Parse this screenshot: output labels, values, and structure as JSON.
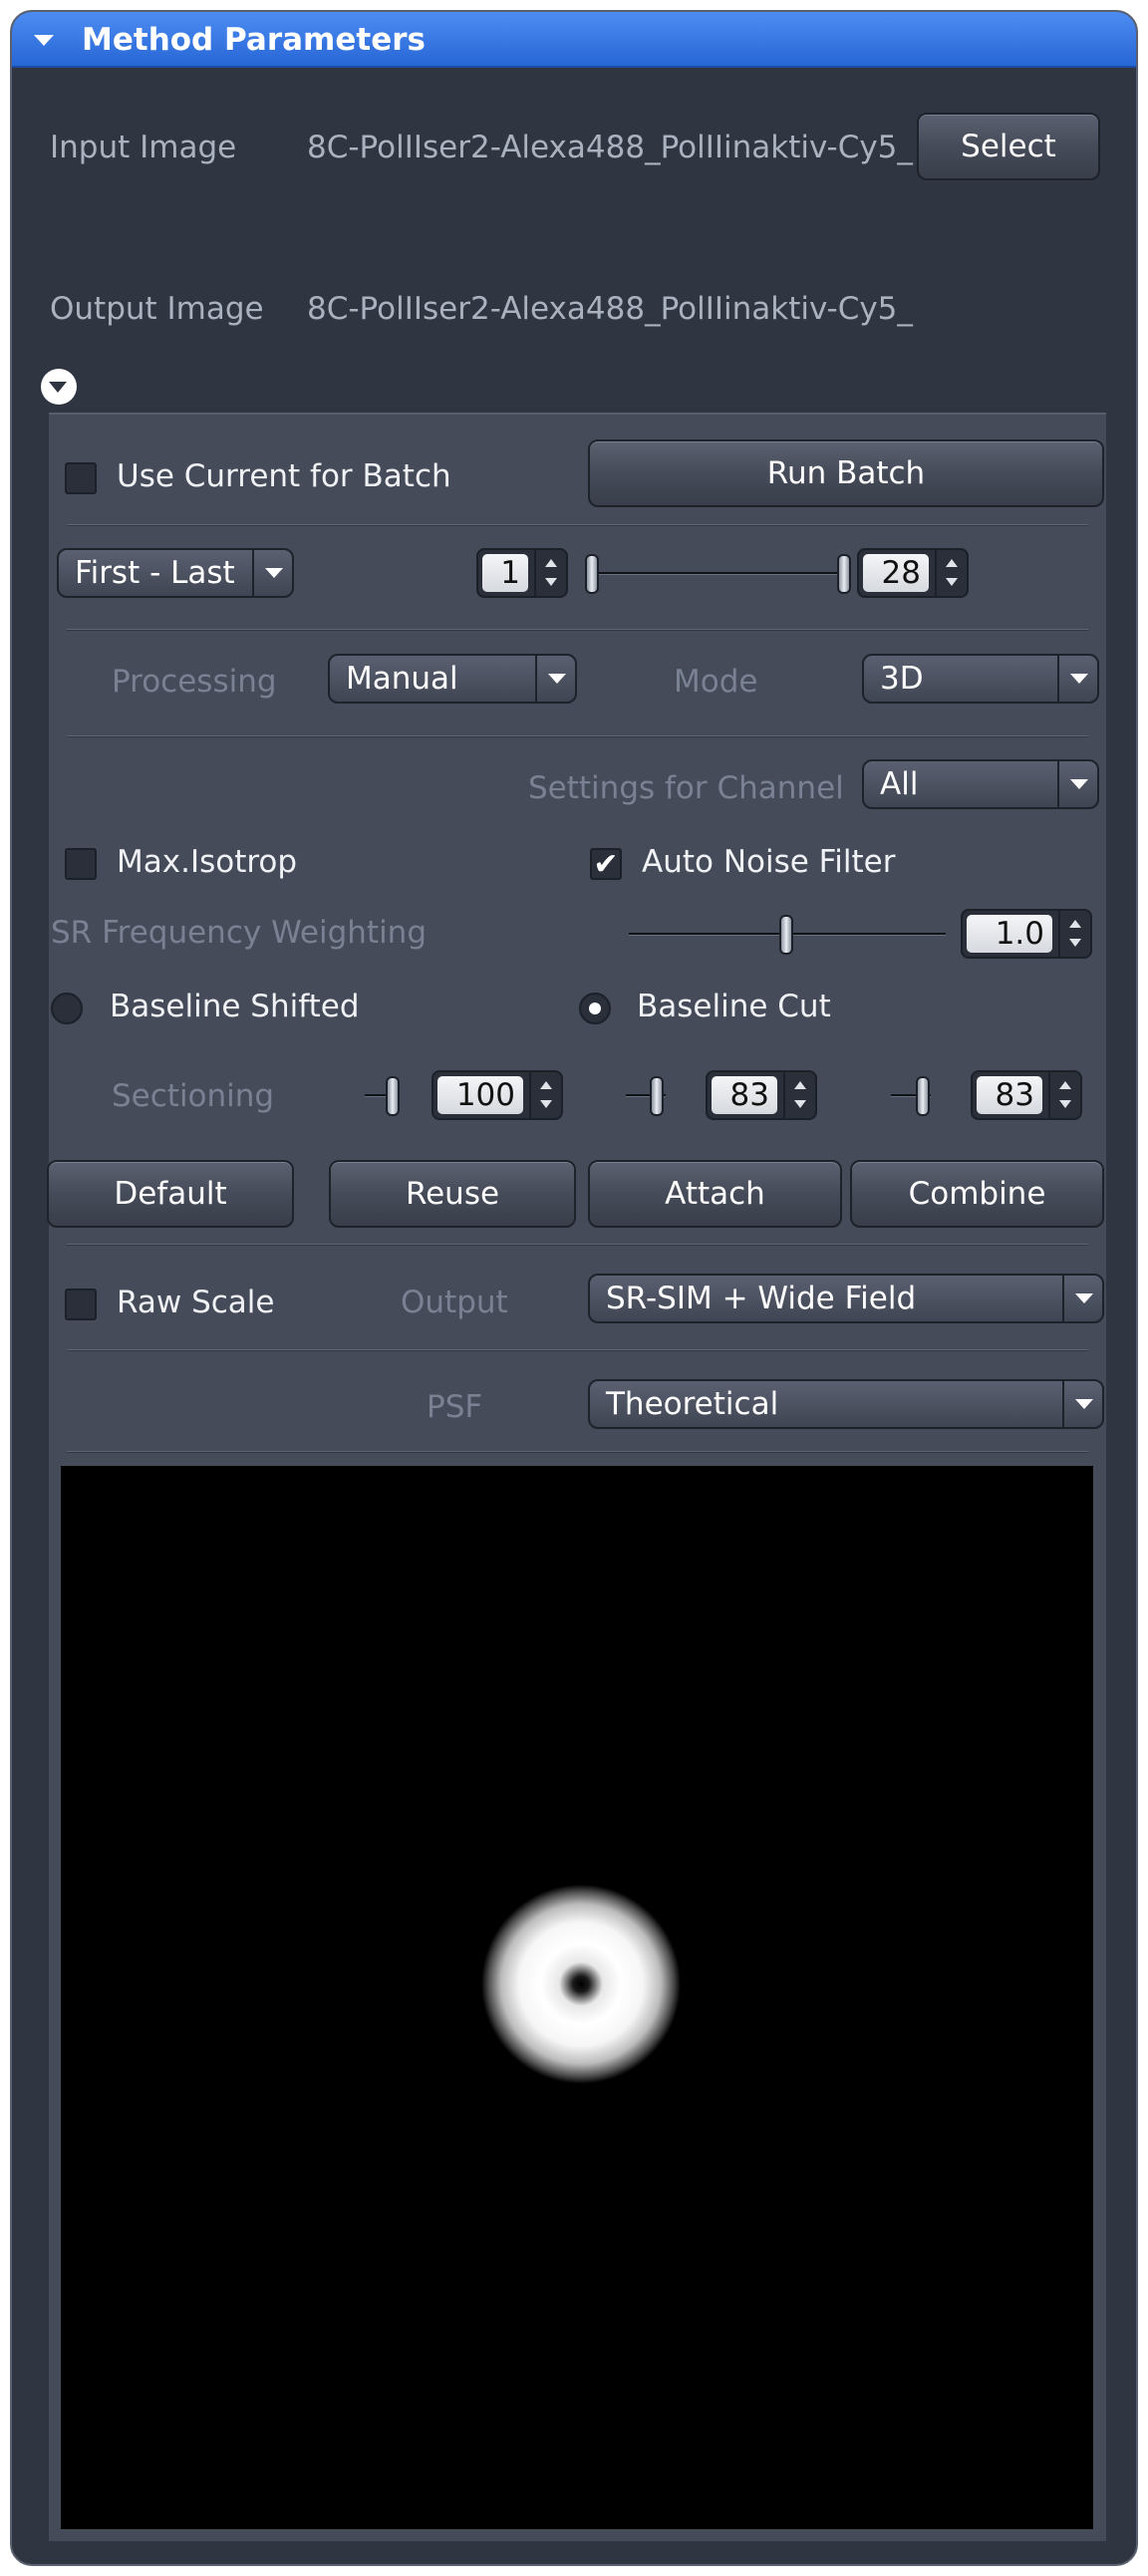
{
  "panel": {
    "title": "Method Parameters",
    "input_label": "Input Image",
    "input_value": "8C-PolIIser2-Alexa488_PolIIinaktiv-Cy5_",
    "select_button": "Select",
    "output_label": "Output Image",
    "output_value": "8C-PolIIser2-Alexa488_PolIIinaktiv-Cy5_"
  },
  "batch": {
    "use_current_label": "Use Current for Batch",
    "use_current_checked": false,
    "run_batch_button": "Run Batch",
    "range_select": "First - Last",
    "range_start": "1",
    "range_end": "28"
  },
  "processing": {
    "processing_label": "Processing",
    "processing_value": "Manual",
    "mode_label": "Mode",
    "mode_value": "3D",
    "channel_label": "Settings for Channel",
    "channel_value": "All"
  },
  "filters": {
    "max_isotrop_label": "Max.Isotrop",
    "max_isotrop_checked": false,
    "auto_noise_label": "Auto Noise Filter",
    "auto_noise_checked": true,
    "sr_weighting_label": "SR Frequency Weighting",
    "sr_weighting_value": "1.0",
    "baseline_shifted_label": "Baseline Shifted",
    "baseline_cut_label": "Baseline Cut",
    "baseline_selected": "Baseline Cut",
    "sectioning_label": "Sectioning",
    "sectioning_values": [
      "100",
      "83",
      "83"
    ]
  },
  "actions": {
    "default_button": "Default",
    "reuse_button": "Reuse",
    "attach_button": "Attach",
    "combine_button": "Combine"
  },
  "output": {
    "raw_scale_label": "Raw Scale",
    "raw_scale_checked": false,
    "output_label": "Output",
    "output_value": "SR-SIM + Wide Field",
    "psf_label": "PSF",
    "psf_value": "Theoretical"
  },
  "icons": {
    "header_toggle": "triangle-down-icon",
    "expand_toggle": "circle-chevron-down-icon",
    "combo_arrow": "triangle-down-icon",
    "spin_up": "triangle-up-icon",
    "spin_down": "triangle-down-icon"
  },
  "colors": {
    "header_blue": "#3478e5",
    "panel_dark": "#2f3541",
    "panel_inner": "#454b59"
  }
}
